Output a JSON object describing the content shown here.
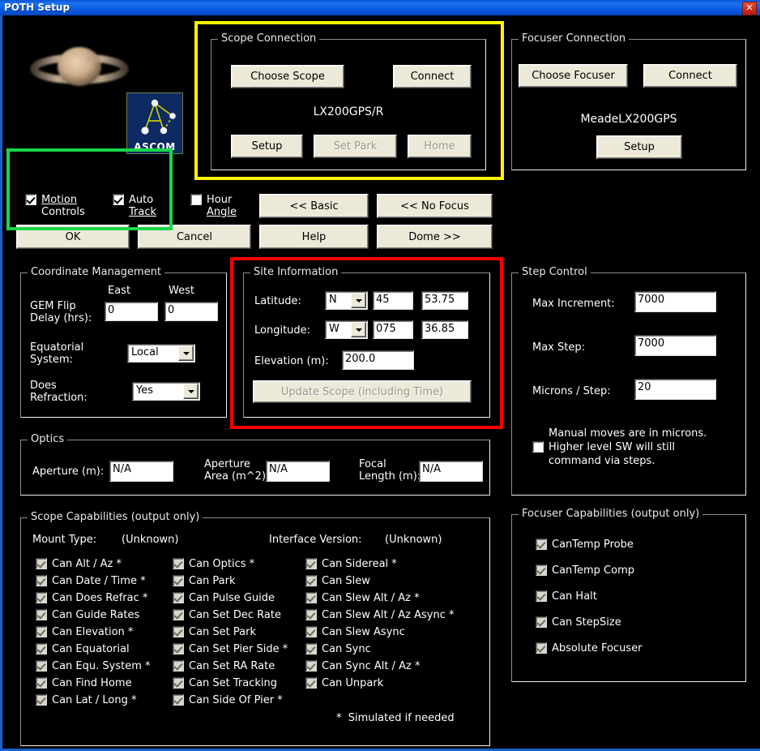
{
  "window": {
    "title": "POTH Setup",
    "close_label": "✕",
    "accent_titlebar": "#1d72f0",
    "highlight_yellow": "#fbf500",
    "highlight_green": "#19d64a",
    "highlight_red": "#f40000"
  },
  "branding": {
    "saturn_alt": "saturn-photo",
    "ascom_label": "ASCOM"
  },
  "scope_connection": {
    "title": "Scope Connection",
    "choose_label": "Choose Scope",
    "connect_label": "Connect",
    "driver_name": "LX200GPS/R",
    "setup_label": "Setup",
    "set_park_label": "Set Park",
    "home_label": "Home"
  },
  "focuser_connection": {
    "title": "Focuser Connection",
    "choose_label": "Choose Focuser",
    "connect_label": "Connect",
    "driver_name": "MeadeLX200GPS",
    "setup_label": "Setup"
  },
  "toggles": {
    "motion_controls": {
      "label_line1": "Motion",
      "label_line2": "Controls",
      "checked": true
    },
    "auto_track": {
      "label_line1": "Auto",
      "label_line2": "Track",
      "checked": true
    },
    "hour_angle": {
      "label_line1": "Hour",
      "label_line2": "Angle",
      "checked": false
    }
  },
  "action_buttons": {
    "basic": "<< Basic",
    "no_focus": "<< No Focus",
    "ok": "OK",
    "cancel": "Cancel",
    "help": "Help",
    "dome": "Dome >>"
  },
  "coordinate_management": {
    "title": "Coordinate Management",
    "col_east": "East",
    "col_west": "West",
    "gem_flip_l1": "GEM Flip",
    "gem_flip_l2": "Delay (hrs):",
    "gem_flip_east": "0",
    "gem_flip_west": "0",
    "equatorial_l1": "Equatorial",
    "equatorial_l2": "System:",
    "equatorial_value": "Local",
    "refraction_l1": "Does",
    "refraction_l2": "Refraction:",
    "refraction_value": "Yes"
  },
  "site_information": {
    "title": "Site Information",
    "latitude_label": "Latitude:",
    "latitude_hemisphere": "N",
    "latitude_deg": "45",
    "latitude_min": "53.75",
    "longitude_label": "Longitude:",
    "longitude_hemisphere": "W",
    "longitude_deg": "075",
    "longitude_min": "36.85",
    "elevation_label": "Elevation (m):",
    "elevation_value": "200.0",
    "update_button": "Update Scope (including Time)"
  },
  "step_control": {
    "title": "Step Control",
    "max_increment_label": "Max Increment:",
    "max_increment_value": "7000",
    "max_step_label": "Max Step:",
    "max_step_value": "7000",
    "microns_label": "Microns / Step:",
    "microns_value": "20",
    "manual_note_l1": "Manual moves are in microns.",
    "manual_note_l2": "Higher level SW will still",
    "manual_note_l3": "command via steps.",
    "manual_checked": false
  },
  "optics": {
    "title": "Optics",
    "aperture_label": "Aperture (m):",
    "aperture_value": "N/A",
    "aperture_area_l1": "Aperture",
    "aperture_area_l2": "Area (m^2):",
    "aperture_area_value": "N/A",
    "focal_l1": "Focal",
    "focal_l2": "Length (m):",
    "focal_value": "N/A"
  },
  "scope_capabilities": {
    "title": "Scope Capabilities  (output only)",
    "mount_type_label": "Mount Type:",
    "mount_type_value": "(Unknown)",
    "interface_version_label": "Interface Version:",
    "interface_version_value": "(Unknown)",
    "footnote": "*  Simulated if needed",
    "column1": [
      {
        "label": "Can Alt / Az *",
        "checked": true
      },
      {
        "label": "Can Date / Time *",
        "checked": true
      },
      {
        "label": "Can Does Refrac *",
        "checked": true
      },
      {
        "label": "Can Guide Rates",
        "checked": true
      },
      {
        "label": "Can Elevation *",
        "checked": true
      },
      {
        "label": "Can Equatorial",
        "checked": true
      },
      {
        "label": "Can Equ. System *",
        "checked": true
      },
      {
        "label": "Can Find Home",
        "checked": true
      },
      {
        "label": "Can Lat / Long *",
        "checked": true
      }
    ],
    "column2": [
      {
        "label": "Can Optics *",
        "checked": true
      },
      {
        "label": "Can Park",
        "checked": true
      },
      {
        "label": "Can Pulse Guide",
        "checked": true
      },
      {
        "label": "Can Set Dec Rate",
        "checked": true
      },
      {
        "label": "Can Set Park",
        "checked": true
      },
      {
        "label": "Can Set Pier Side *",
        "checked": true
      },
      {
        "label": "Can Set RA Rate",
        "checked": true
      },
      {
        "label": "Can Set Tracking",
        "checked": true
      },
      {
        "label": "Can Side Of Pier *",
        "checked": true
      }
    ],
    "column3": [
      {
        "label": "Can Sidereal *",
        "checked": true
      },
      {
        "label": "Can Slew",
        "checked": true
      },
      {
        "label": "Can Slew Alt / Az *",
        "checked": true
      },
      {
        "label": "Can Slew Alt / Az Async *",
        "checked": true
      },
      {
        "label": "Can Slew Async",
        "checked": true
      },
      {
        "label": "Can Sync",
        "checked": true
      },
      {
        "label": "Can Sync Alt / Az *",
        "checked": true
      },
      {
        "label": "Can Unpark",
        "checked": true
      }
    ]
  },
  "focuser_capabilities": {
    "title": "Focuser Capabilities (output only)",
    "items": [
      {
        "label": "CanTemp Probe",
        "checked": true
      },
      {
        "label": "CanTemp Comp",
        "checked": true
      },
      {
        "label": "Can Halt",
        "checked": true
      },
      {
        "label": "Can StepSize",
        "checked": true
      },
      {
        "label": "Absolute Focuser",
        "checked": true
      }
    ]
  }
}
